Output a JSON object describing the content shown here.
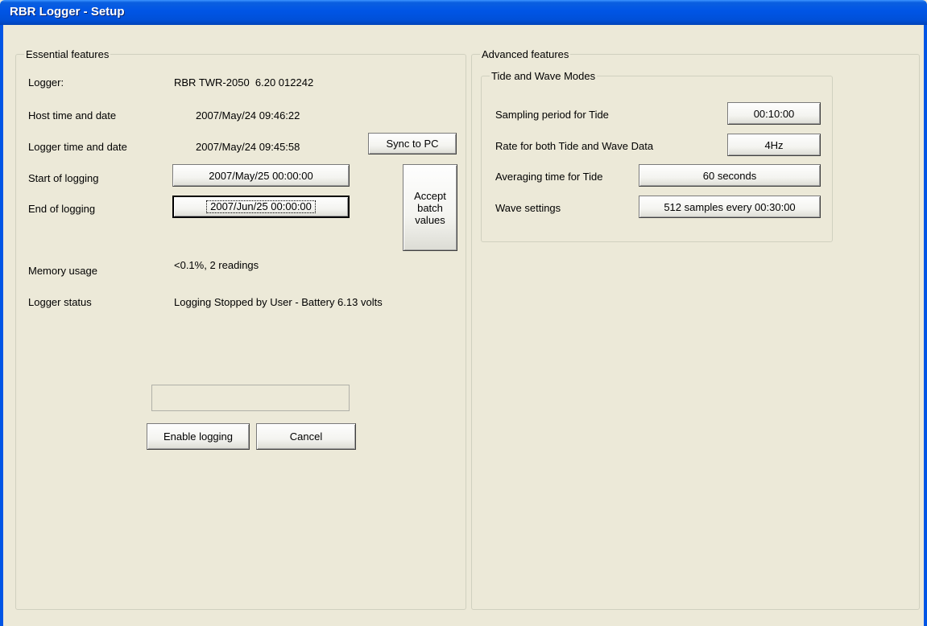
{
  "window": {
    "title": "RBR Logger - Setup"
  },
  "essential": {
    "legend": "Essential features",
    "logger_label": "Logger:",
    "logger_value": "RBR TWR-2050  6.20 012242",
    "host_time_label": "Host time and date",
    "host_time_value": "2007/May/24 09:46:22",
    "logger_time_label": "Logger time and date",
    "logger_time_value": "2007/May/24 09:45:58",
    "sync_button": "Sync to PC",
    "start_label": "Start of logging",
    "start_value": "2007/May/25 00:00:00",
    "end_label": "End of logging",
    "end_value": "2007/Jun/25 00:00:00",
    "accept_batch_lines": [
      "Accept",
      "batch",
      "values"
    ],
    "memory_label": "Memory usage",
    "memory_value": "<0.1%, 2 readings",
    "status_label": "Logger status",
    "status_value": "Logging Stopped by User - Battery 6.13 volts",
    "enable_button": "Enable logging",
    "cancel_button": "Cancel"
  },
  "advanced": {
    "legend": "Advanced features",
    "tide_wave": {
      "legend": "Tide and Wave Modes",
      "sampling_label": "Sampling period for Tide",
      "sampling_value": "00:10:00",
      "rate_label": "Rate for both Tide and Wave Data",
      "rate_value": "4Hz",
      "averaging_label": "Averaging time for Tide",
      "averaging_value": "60 seconds",
      "wave_label": "Wave settings",
      "wave_value": "512 samples every 00:30:00"
    }
  }
}
